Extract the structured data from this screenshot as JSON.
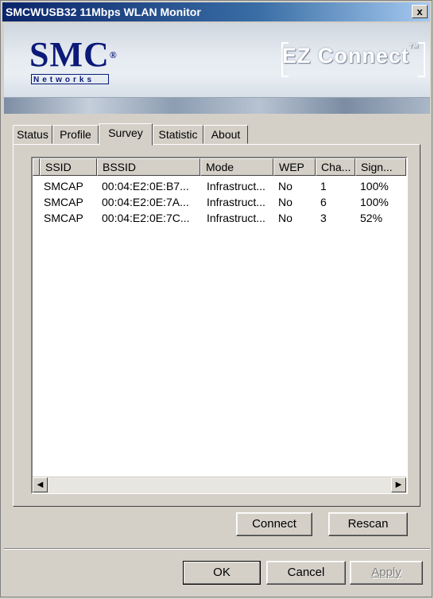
{
  "window": {
    "title": "SMCWUSB32 11Mbps WLAN Monitor",
    "close_label": "x"
  },
  "banner": {
    "logo_main": "SMC",
    "logo_registered": "®",
    "logo_sub": "Networks",
    "product": "EZ Connect",
    "product_tm": "TM"
  },
  "tabs": [
    {
      "label": "Status"
    },
    {
      "label": "Profile"
    },
    {
      "label": "Survey",
      "active": true
    },
    {
      "label": "Statistic"
    },
    {
      "label": "About"
    }
  ],
  "survey": {
    "columns": [
      "SSID",
      "BSSID",
      "Mode",
      "WEP",
      "Cha...",
      "Sign..."
    ],
    "rows": [
      [
        "SMCAP",
        "00:04:E2:0E:B7...",
        "Infrastruct...",
        "No",
        "1",
        "100%"
      ],
      [
        "SMCAP",
        "00:04:E2:0E:7A...",
        "Infrastruct...",
        "No",
        "6",
        "100%"
      ],
      [
        "SMCAP",
        "00:04:E2:0E:7C...",
        "Infrastruct...",
        "No",
        "3",
        "52%"
      ]
    ],
    "connect_label": "Connect",
    "rescan_label": "Rescan"
  },
  "footer": {
    "ok_label": "OK",
    "cancel_label": "Cancel",
    "apply_label": "Apply"
  },
  "colors": {
    "dialog_bg": "#d4d0c8",
    "titlebar": "#0a246a",
    "logo": "#0b1a78"
  },
  "icons": {
    "scroll_left": "scroll-left-arrow-icon",
    "scroll_right": "scroll-right-arrow-icon"
  }
}
